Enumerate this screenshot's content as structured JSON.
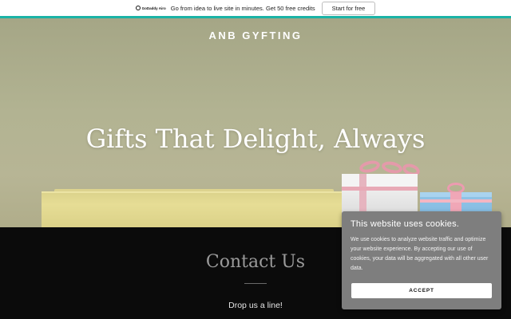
{
  "promo_bar": {
    "logo_text": "GoDaddy Airo",
    "message": "Go from idea to live site in minutes. Get 50 free credits",
    "cta_label": "Start for free",
    "accent_color": "#1bb3a6"
  },
  "header": {
    "brand": "ANB GYFTING"
  },
  "hero": {
    "title": "Gifts That Delight, Always"
  },
  "contact": {
    "title": "Contact Us",
    "subtitle": "Drop us a line!"
  },
  "cookie_banner": {
    "title": "This website uses cookies.",
    "body": "We use cookies to analyze website traffic and optimize your website experience. By accepting our use of cookies, your data will be aggregated with all other user data.",
    "accept_label": "ACCEPT"
  }
}
